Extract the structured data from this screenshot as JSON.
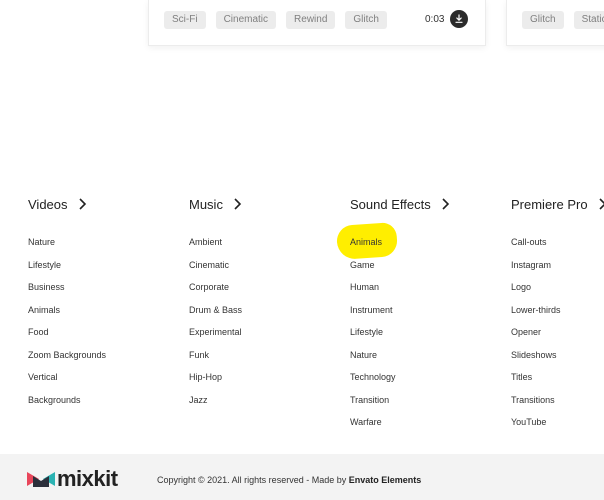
{
  "cards": [
    {
      "tags": [
        "Sci-Fi",
        "Cinematic",
        "Rewind",
        "Glitch"
      ],
      "duration": "0:03"
    },
    {
      "tags": [
        "Glitch",
        "Static"
      ]
    }
  ],
  "footer": {
    "columns": [
      {
        "title": "Videos",
        "items": [
          "Nature",
          "Lifestyle",
          "Business",
          "Animals",
          "Food",
          "Zoom Backgrounds",
          "Vertical",
          "Backgrounds"
        ]
      },
      {
        "title": "Music",
        "items": [
          "Ambient",
          "Cinematic",
          "Corporate",
          "Drum & Bass",
          "Experimental",
          "Funk",
          "Hip-Hop",
          "Jazz"
        ]
      },
      {
        "title": "Sound Effects",
        "items": [
          "Animals",
          "Game",
          "Human",
          "Instrument",
          "Lifestyle",
          "Nature",
          "Technology",
          "Transition",
          "Warfare"
        ]
      },
      {
        "title": "Premiere Pro",
        "items": [
          "Call-outs",
          "Instagram",
          "Logo",
          "Lower-thirds",
          "Opener",
          "Slideshows",
          "Titles",
          "Transitions",
          "YouTube"
        ]
      }
    ],
    "highlighted_item": "Animals",
    "brand": "mixkit",
    "copyright_prefix": "Copyright © 2021. All rights reserved - Made by ",
    "copyright_company": "Envato Elements"
  },
  "colors": {
    "highlight": "#ffee00",
    "logo_red": "#e8455a",
    "logo_teal": "#2bb3b3",
    "logo_dark": "#2b2f3a"
  }
}
